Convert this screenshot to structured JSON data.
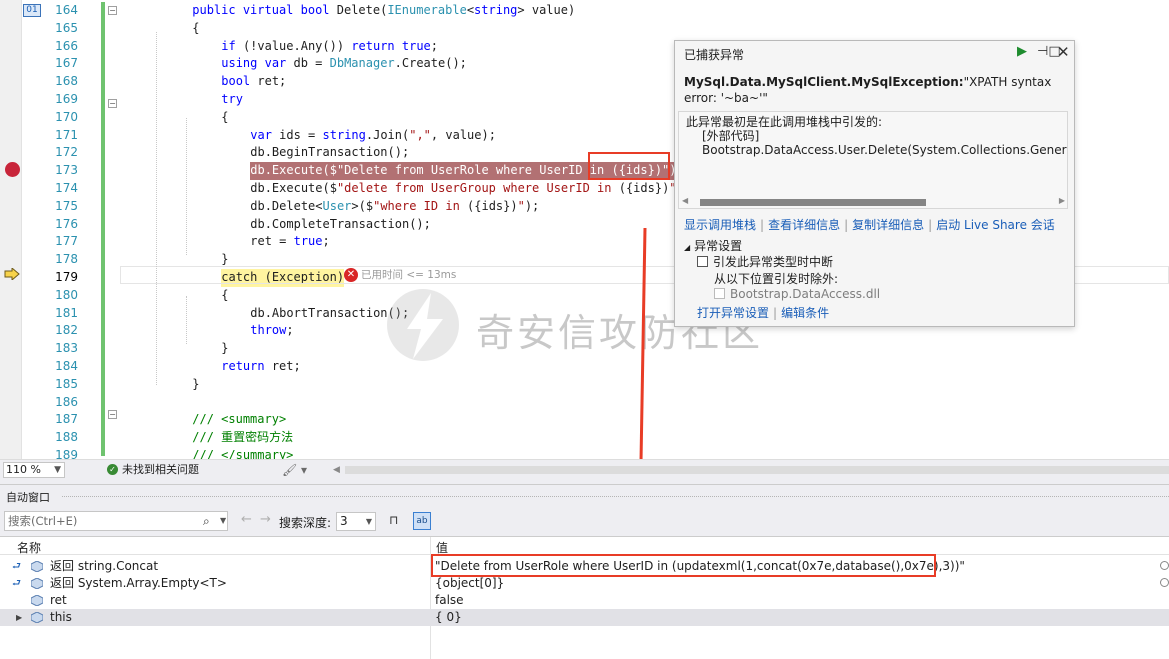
{
  "editor": {
    "lines": [
      {
        "num": "164",
        "parts": [
          [
            "kw",
            "public virtual bool "
          ],
          [
            "",
            "Delete("
          ],
          [
            "ty",
            "IEnumerable"
          ],
          [
            "",
            "<"
          ],
          [
            "kw",
            "string"
          ],
          [
            "",
            "> value)"
          ]
        ],
        "indent": 8
      },
      {
        "num": "165",
        "parts": [
          [
            "",
            "{"
          ]
        ],
        "indent": 8
      },
      {
        "num": "166",
        "parts": [
          [
            "kw",
            "if "
          ],
          [
            "",
            "(!value.Any()) "
          ],
          [
            "kw",
            "return true"
          ],
          [
            "",
            ";"
          ]
        ],
        "indent": 12
      },
      {
        "num": "167",
        "parts": [
          [
            "kw",
            "using var "
          ],
          [
            "",
            "db = "
          ],
          [
            "ty",
            "DbManager"
          ],
          [
            "",
            ".Create();"
          ]
        ],
        "indent": 12
      },
      {
        "num": "168",
        "parts": [
          [
            "kw",
            "bool "
          ],
          [
            "",
            "ret;"
          ]
        ],
        "indent": 12
      },
      {
        "num": "169",
        "parts": [
          [
            "kw",
            "try"
          ]
        ],
        "indent": 12
      },
      {
        "num": "170",
        "parts": [
          [
            "",
            "{"
          ]
        ],
        "indent": 12
      },
      {
        "num": "171",
        "parts": [
          [
            "kw",
            "var "
          ],
          [
            "",
            "ids = "
          ],
          [
            "kw",
            "string"
          ],
          [
            "",
            ".Join("
          ],
          [
            "str",
            "\",\""
          ],
          [
            "",
            ", value);"
          ]
        ],
        "indent": 16
      },
      {
        "num": "172",
        "parts": [
          [
            "",
            "db.BeginTransaction();"
          ]
        ],
        "indent": 16
      },
      {
        "num": "173",
        "parts": [
          [
            "",
            "db.Execute($\"Delete from UserRole where UserID in ({ids})\");"
          ]
        ],
        "indent": 16
      },
      {
        "num": "174",
        "parts": [
          [
            "",
            "db.Execute($"
          ],
          [
            "str",
            "\"delete from UserGroup where UserID in "
          ],
          [
            "",
            "({ids})"
          ],
          [
            "str",
            "\""
          ],
          [
            "",
            ");"
          ]
        ],
        "indent": 16
      },
      {
        "num": "175",
        "parts": [
          [
            "",
            "db.Delete<"
          ],
          [
            "ty",
            "User"
          ],
          [
            "",
            ">($"
          ],
          [
            "str",
            "\"where ID in "
          ],
          [
            "",
            "({ids})"
          ],
          [
            "str",
            "\""
          ],
          [
            "",
            ");"
          ]
        ],
        "indent": 16
      },
      {
        "num": "176",
        "parts": [
          [
            "",
            "db.CompleteTransaction();"
          ]
        ],
        "indent": 16
      },
      {
        "num": "177",
        "parts": [
          [
            "",
            "ret = "
          ],
          [
            "kw",
            "true"
          ],
          [
            "",
            ";"
          ]
        ],
        "indent": 16
      },
      {
        "num": "178",
        "parts": [
          [
            "",
            "}"
          ]
        ],
        "indent": 12
      },
      {
        "num": "179",
        "parts": [
          [
            "",
            "catch (Exception)"
          ]
        ],
        "indent": 12
      },
      {
        "num": "180",
        "parts": [
          [
            "",
            "{"
          ]
        ],
        "indent": 12
      },
      {
        "num": "181",
        "parts": [
          [
            "",
            "db.AbortTransaction();"
          ]
        ],
        "indent": 16
      },
      {
        "num": "182",
        "parts": [
          [
            "kw",
            "throw"
          ],
          [
            "",
            ";"
          ]
        ],
        "indent": 16
      },
      {
        "num": "183",
        "parts": [
          [
            "",
            "}"
          ]
        ],
        "indent": 12
      },
      {
        "num": "184",
        "parts": [
          [
            "kw",
            "return "
          ],
          [
            "",
            "ret;"
          ]
        ],
        "indent": 12
      },
      {
        "num": "185",
        "parts": [
          [
            "",
            "}"
          ]
        ],
        "indent": 8
      },
      {
        "num": "186",
        "parts": [],
        "indent": 8
      },
      {
        "num": "187",
        "parts": [
          [
            "cm",
            "/// <summary>"
          ]
        ],
        "indent": 8
      },
      {
        "num": "188",
        "parts": [
          [
            "cm",
            "/// 重置密码方法"
          ]
        ],
        "indent": 8
      },
      {
        "num": "189",
        "parts": [
          [
            "cm",
            "/// </summary>"
          ]
        ],
        "indent": 8
      }
    ],
    "elapsed": "已用时间 <= 13ms",
    "watermark": "奇安信攻防社区"
  },
  "popup": {
    "title": "已捕获异常",
    "exception_type": "MySql.Data.MySqlClient.MySqlException:",
    "exception_msg": "\"XPATH syntax error: '~ba~'\"",
    "detail_line1": "此异常最初是在此调用堆栈中引发的:",
    "detail_line2": "[外部代码]",
    "detail_line3": "Bootstrap.DataAccess.User.Delete(System.Collections.Generic.IEn",
    "links": [
      "显示调用堆栈",
      "查看详细信息",
      "复制详细信息",
      "启动 Live Share 会话"
    ],
    "settings_title": "异常设置",
    "setting_break": "引发此异常类型时中断",
    "setting_except": "从以下位置引发时除外:",
    "setting_module": "Bootstrap.DataAccess.dll",
    "link_open": "打开异常设置",
    "link_edit": "编辑条件"
  },
  "status": {
    "zoom": "110 %",
    "issues": "未找到相关问题"
  },
  "autos": {
    "title": "自动窗口",
    "search_placeholder": "搜索(Ctrl+E)",
    "depth_label": "搜索深度:",
    "depth_value": "3",
    "col_name": "名称",
    "col_value": "值",
    "rows": [
      {
        "name": "返回 string.Concat",
        "value": "\"Delete from UserRole where UserID in (updatexml(1,concat(0x7e,database(),0x7e),3))\""
      },
      {
        "name": "返回 System.Array.Empty<T>",
        "value": "{object[0]}"
      },
      {
        "name": "ret",
        "value": "false"
      },
      {
        "name": "this",
        "value": "{ 0}"
      }
    ]
  },
  "colors": {
    "keyword": "#0000ff",
    "type": "#2b91af",
    "string": "#a31515",
    "comment": "#008000",
    "breakpoint": "#c8253a",
    "highlight_line": "#b27173",
    "annotation_red": "#e83c26"
  }
}
